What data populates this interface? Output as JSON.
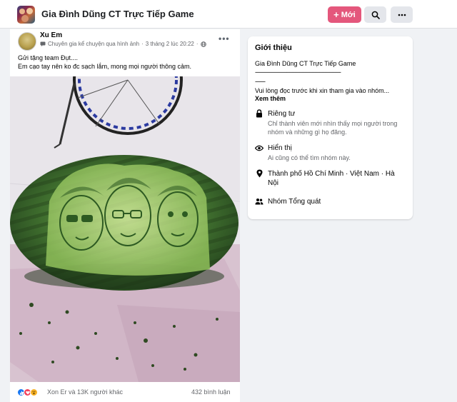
{
  "header": {
    "group_name": "Gia Đình Dũng CT Trực Tiếp Game",
    "new_button": "Mới",
    "new_button_icon": "plus-icon",
    "search_icon": "search-icon",
    "more_icon": "more-icon",
    "accent": "#e4577c"
  },
  "post": {
    "author": "Xu Em",
    "badge": "Chuyên gia kể chuyện qua hình ảnh",
    "date": "3 tháng 2 lúc 20:22",
    "separator": "·",
    "privacy_icon": "globe-icon",
    "text_line1": "Gửi tặng team Đụt....",
    "text_line2": "Em cạo tay nên ko đc sạch lắm, mong mọi người thông cảm.",
    "reactions_text": "Xon Er và 13K người khác",
    "reaction_icons": [
      "like-icon",
      "love-icon",
      "wow-icon"
    ],
    "comments": "432 bình luận"
  },
  "about": {
    "title": "Giới thiệu",
    "description": "Gia Đình Dũng CT Trực Tiếp Game",
    "dashes_line1": "------------------------------------------------------------",
    "dashes_line2": "-------",
    "rules": "Vui lòng đọc trước khi xin tham gia vào nhóm...",
    "see_more": "Xem thêm",
    "private_title": "Riêng tư",
    "private_sub": "Chỉ thành viên mới nhìn thấy mọi người trong nhóm và những gì họ đăng.",
    "visible_title": "Hiển thị",
    "visible_sub": "Ai cũng có thể tìm nhóm này.",
    "location": "Thành phố Hồ Chí Minh · Việt Nam · Hà Nội",
    "group_type": "Nhóm Tổng quát"
  }
}
